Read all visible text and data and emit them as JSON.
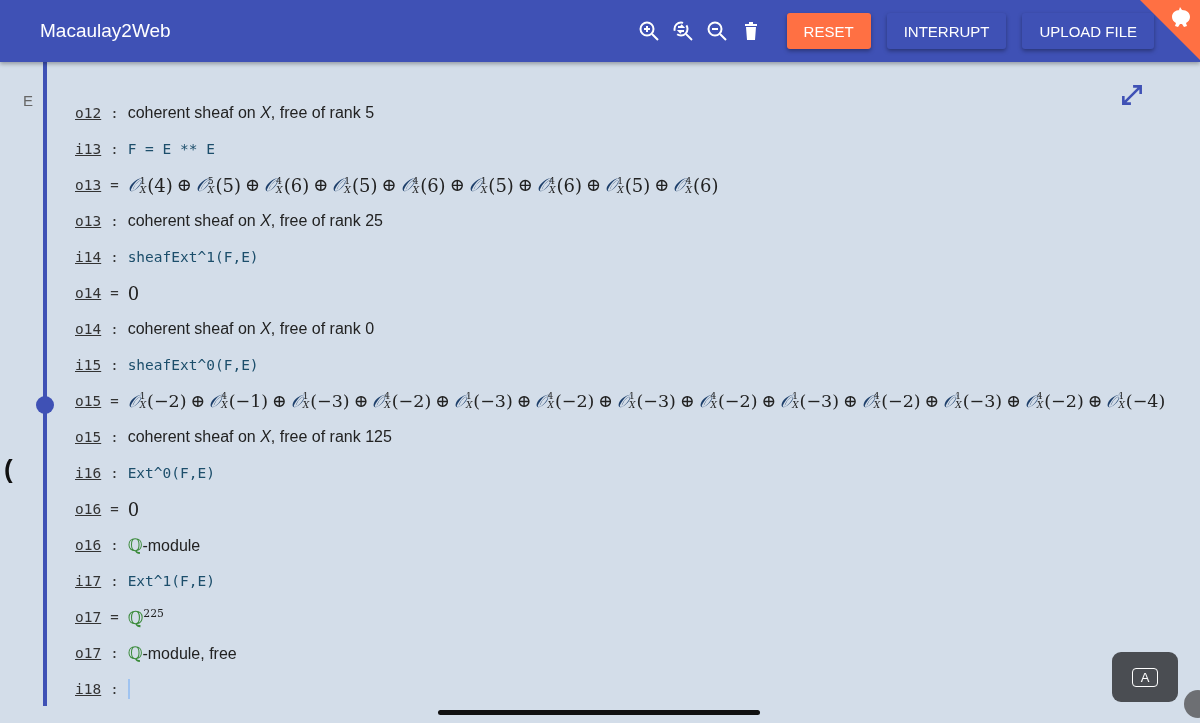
{
  "header": {
    "title": "Macaulay2Web",
    "buttons": [
      {
        "label": "RESET",
        "kind": "danger"
      },
      {
        "label": "INTERRUPT",
        "kind": "primary"
      },
      {
        "label": "UPLOAD FILE",
        "kind": "primary"
      }
    ]
  },
  "gutter": [
    {
      "text": "E"
    },
    {
      "text": "("
    }
  ],
  "rows": [
    {
      "kind": "type",
      "label": "o12",
      "sep": ":",
      "text": "coherent sheaf on *X*, free of rank 5"
    },
    {
      "kind": "input",
      "label": "i13",
      "sep": ":",
      "code": "F = E ** E"
    },
    {
      "kind": "output",
      "label": "o13",
      "sep": "=",
      "terms": [
        {
          "base": "𝒪",
          "sub": "X",
          "sup": "1",
          "arg": "(4)"
        },
        {
          "op": "⊕",
          "base": "𝒪",
          "sub": "X",
          "sup": "5",
          "arg": "(5)"
        },
        {
          "op": "⊕",
          "base": "𝒪",
          "sub": "X",
          "sup": "4",
          "arg": "(6)"
        },
        {
          "op": "⊕",
          "base": "𝒪",
          "sub": "X",
          "sup": "1",
          "arg": "(5)"
        },
        {
          "op": "⊕",
          "base": "𝒪",
          "sub": "X",
          "sup": "4",
          "arg": "(6)"
        },
        {
          "op": "⊕",
          "base": "𝒪",
          "sub": "X",
          "sup": "1",
          "arg": "(5)"
        },
        {
          "op": "⊕",
          "base": "𝒪",
          "sub": "X",
          "sup": "4",
          "arg": "(6)"
        },
        {
          "op": "⊕",
          "base": "𝒪",
          "sub": "X",
          "sup": "1",
          "arg": "(5)"
        },
        {
          "op": "⊕",
          "base": "𝒪",
          "sub": "X",
          "sup": "4",
          "arg": "(6)"
        }
      ]
    },
    {
      "kind": "type",
      "label": "o13",
      "sep": ":",
      "text": "coherent sheaf on *X*, free of rank 25"
    },
    {
      "kind": "input",
      "label": "i14",
      "sep": ":",
      "code": "sheafExt^1(F,E)"
    },
    {
      "kind": "output",
      "label": "o14",
      "sep": "=",
      "value": "0"
    },
    {
      "kind": "type",
      "label": "o14",
      "sep": ":",
      "text": "coherent sheaf on *X*, free of rank 0"
    },
    {
      "kind": "input",
      "label": "i15",
      "sep": ":",
      "code": "sheafExt^0(F,E)"
    },
    {
      "kind": "output",
      "label": "o15",
      "sep": "=",
      "terms": [
        {
          "base": "𝒪",
          "sub": "X",
          "sup": "1",
          "arg": "(−2)"
        },
        {
          "op": "⊕",
          "base": "𝒪",
          "sub": "X",
          "sup": "4",
          "arg": "(−1)"
        },
        {
          "op": "⊕",
          "base": "𝒪",
          "sub": "X",
          "sup": "1",
          "arg": "(−3)"
        },
        {
          "op": "⊕",
          "base": "𝒪",
          "sub": "X",
          "sup": "4",
          "arg": "(−2)"
        },
        {
          "op": "⊕",
          "base": "𝒪",
          "sub": "X",
          "sup": "1",
          "arg": "(−3)"
        },
        {
          "op": "⊕",
          "base": "𝒪",
          "sub": "X",
          "sup": "4",
          "arg": "(−2)"
        },
        {
          "op": "⊕",
          "base": "𝒪",
          "sub": "X",
          "sup": "1",
          "arg": "(−3)"
        },
        {
          "op": "⊕",
          "base": "𝒪",
          "sub": "X",
          "sup": "4",
          "arg": "(−2)"
        },
        {
          "op": "⊕",
          "base": "𝒪",
          "sub": "X",
          "sup": "1",
          "arg": "(−3)"
        },
        {
          "op": "⊕",
          "base": "𝒪",
          "sub": "X",
          "sup": "4",
          "arg": "(−2)"
        },
        {
          "op": "⊕",
          "base": "𝒪",
          "sub": "X",
          "sup": "1",
          "arg": "(−3)"
        },
        {
          "op": "⊕",
          "base": "𝒪",
          "sub": "X",
          "sup": "4",
          "arg": "(−2)"
        },
        {
          "op": "⊕",
          "base": "𝒪",
          "sub": "X",
          "sup": "1",
          "arg": "(−4)"
        }
      ]
    },
    {
      "kind": "type",
      "label": "o15",
      "sep": ":",
      "text": "coherent sheaf on *X*, free of rank 125"
    },
    {
      "kind": "input",
      "label": "i16",
      "sep": ":",
      "code": "Ext^0(F,E)"
    },
    {
      "kind": "output",
      "label": "o16",
      "sep": "=",
      "value": "0"
    },
    {
      "kind": "type",
      "label": "o16",
      "sep": ":",
      "ring": "ℚ",
      "text": "-module"
    },
    {
      "kind": "input",
      "label": "i17",
      "sep": ":",
      "code": "Ext^1(F,E)"
    },
    {
      "kind": "output",
      "label": "o17",
      "sep": "=",
      "ring": "ℚ",
      "power": "225"
    },
    {
      "kind": "type",
      "label": "o17",
      "sep": ":",
      "ring": "ℚ",
      "text": "-module, free"
    },
    {
      "kind": "prompt",
      "label": "i18",
      "sep": ":"
    }
  ],
  "keyboard_button": {
    "label": "A"
  }
}
